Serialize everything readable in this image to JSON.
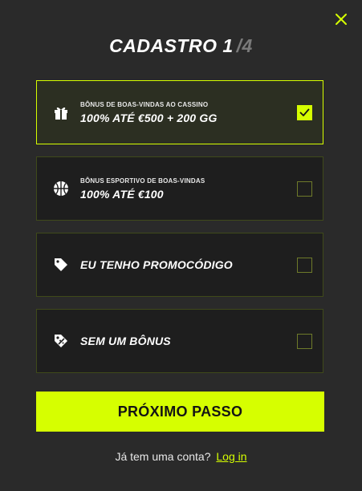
{
  "header": {
    "title": "CADASTRO 1",
    "step_separator": "/",
    "step_total": "4"
  },
  "options": [
    {
      "subtitle": "Bônus de boas-vindas ao cassino",
      "label": "100% ATÉ €500 + 200 GG",
      "icon": "gift-icon",
      "checked": true
    },
    {
      "subtitle": "Bônus esportivo de boas-vindas",
      "label": "100% ATÉ €100",
      "icon": "basketball-icon",
      "checked": false
    },
    {
      "subtitle": "",
      "label": "EU TENHO PROMOCÓDIGO",
      "icon": "tag-icon",
      "checked": false
    },
    {
      "subtitle": "",
      "label": "SEM UM BÔNUS",
      "icon": "no-discount-tag-icon",
      "checked": false
    }
  ],
  "actions": {
    "next_label": "PRÓXIMO PASSO"
  },
  "footer": {
    "prompt": "Já tem uma conta?",
    "login_label": "Log in"
  },
  "colors": {
    "accent": "#d6ff00",
    "background": "#2a2a2a",
    "card": "#1e1e1e",
    "selected_card": "#2c2f22",
    "border": "#3f4a1a"
  }
}
